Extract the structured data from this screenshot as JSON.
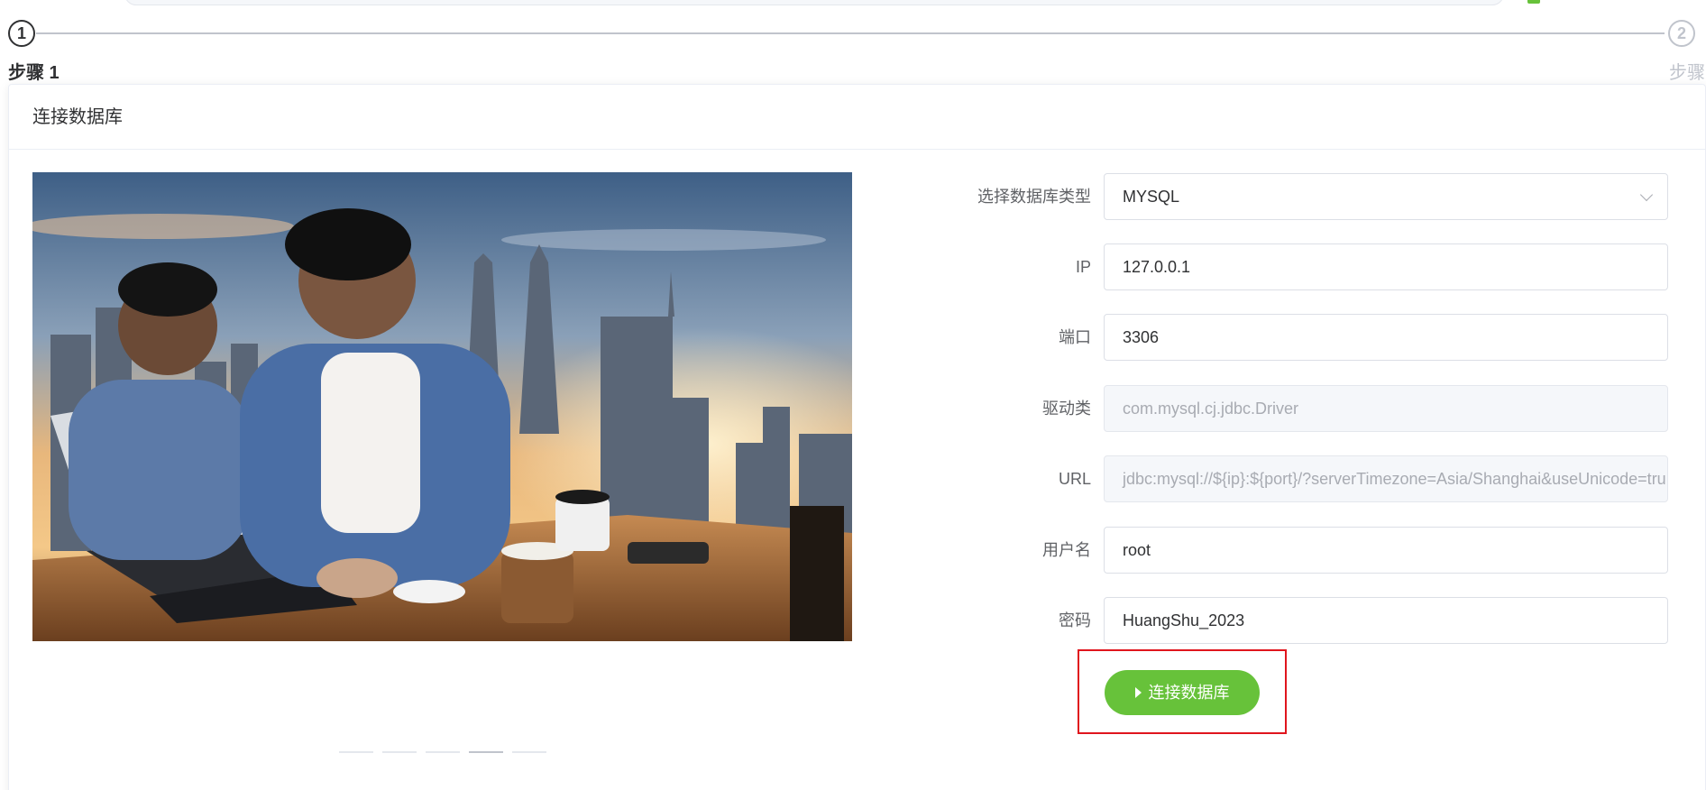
{
  "steps": [
    {
      "number": "1",
      "title": "步骤 1",
      "state": "active"
    },
    {
      "number": "2",
      "title": "步骤",
      "state": "inactive"
    }
  ],
  "card": {
    "title": "连接数据库"
  },
  "carousel": {
    "image_alt": "two-developers-at-laptop-city-skyline-photo",
    "indicator_count": 5,
    "active_index": 3
  },
  "form": {
    "db_type": {
      "label": "选择数据库类型",
      "value": "MYSQL"
    },
    "ip": {
      "label": "IP",
      "value": "127.0.0.1"
    },
    "port": {
      "label": "端口",
      "value": "3306"
    },
    "driver": {
      "label": "驱动类",
      "placeholder": "com.mysql.cj.jdbc.Driver"
    },
    "url": {
      "label": "URL",
      "placeholder": "jdbc:mysql://${ip}:${port}/?serverTimezone=Asia/Shanghai&useUnicode=tru"
    },
    "username": {
      "label": "用户名",
      "value": "root"
    },
    "password": {
      "label": "密码",
      "value": "HuangShu_2023"
    }
  },
  "connect_button": {
    "label": "连接数据库",
    "icon": "play-icon"
  },
  "colors": {
    "primary_green": "#67c23a",
    "highlight_red": "#e0151d",
    "text": "#303133",
    "muted": "#c0c4cc"
  }
}
